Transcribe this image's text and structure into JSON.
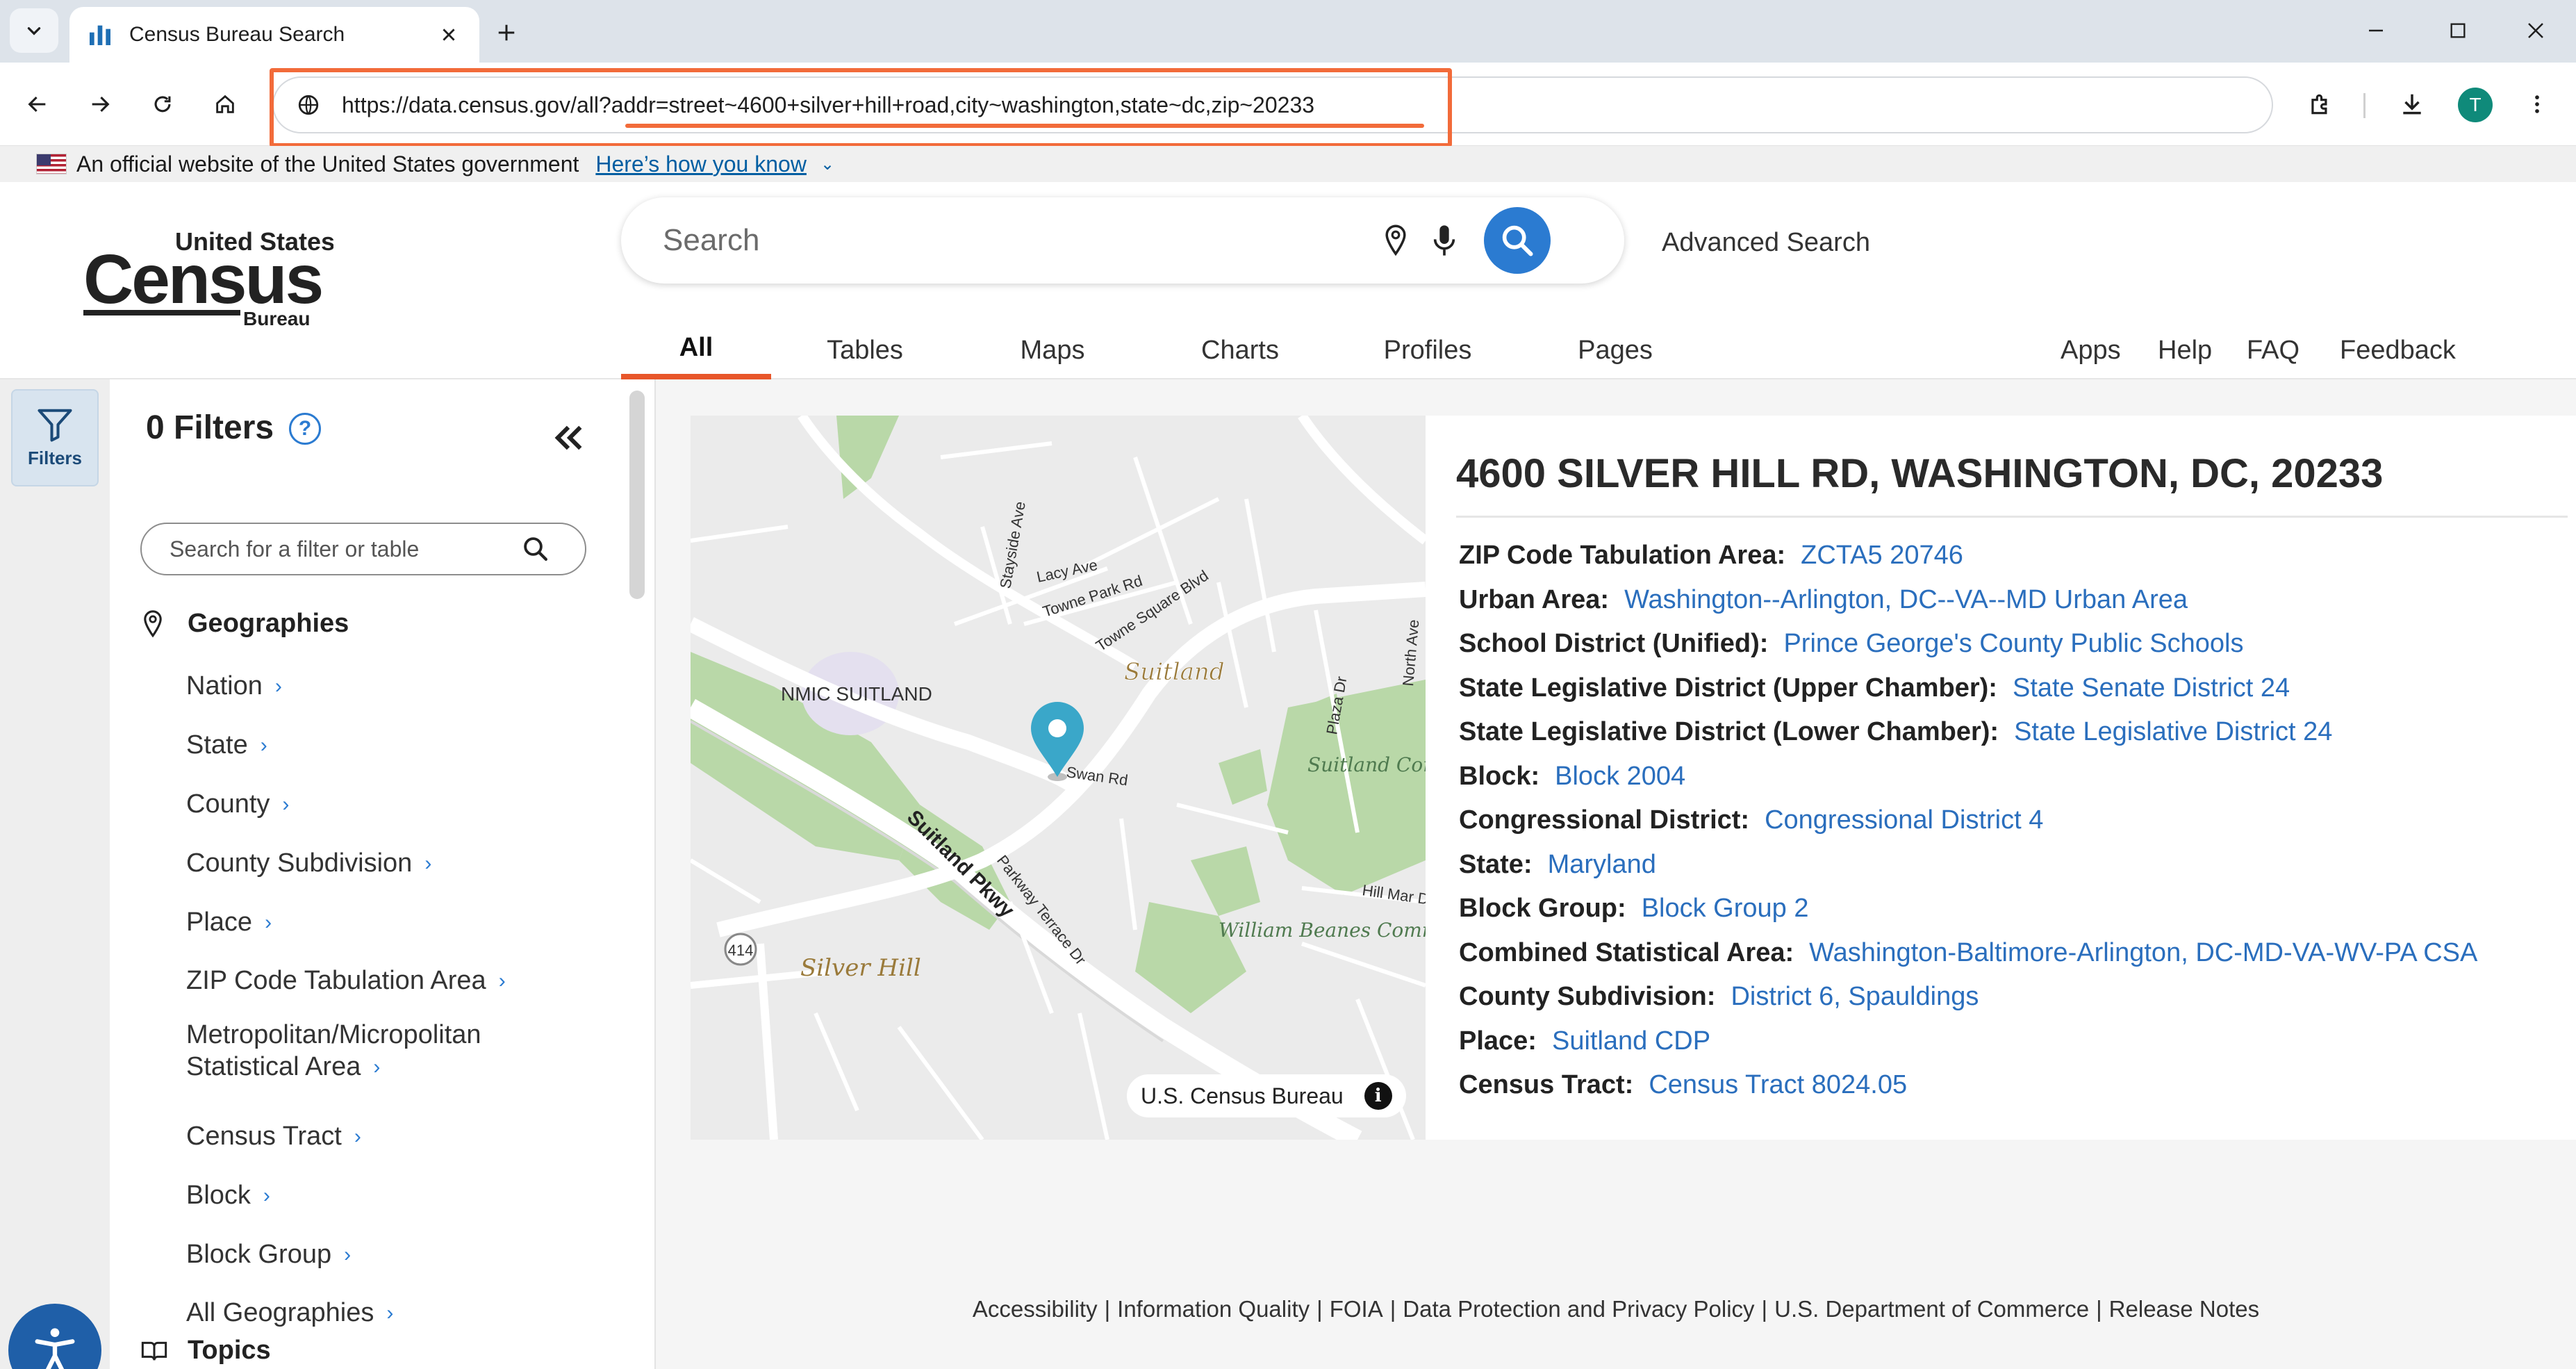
{
  "browser": {
    "tab_title": "Census Bureau Search",
    "url_host": "https://data.census.gov/",
    "url_path": "all?addr=street~4600+silver+hill+road,city~washington,state~dc,zip~20233",
    "profile_initial": "T"
  },
  "gov_banner": {
    "text": "An official website of the United States government",
    "link": "Here’s how you know"
  },
  "logo": {
    "line1": "United States",
    "line2": "Census",
    "line3": "Bureau"
  },
  "search": {
    "placeholder": "Search",
    "advanced": "Advanced Search"
  },
  "tabs": [
    "All",
    "Tables",
    "Maps",
    "Charts",
    "Profiles",
    "Pages"
  ],
  "right_links": [
    "Apps",
    "Help",
    "FAQ",
    "Feedback"
  ],
  "rail": {
    "filters_label": "Filters"
  },
  "filter_panel": {
    "title": "0 Filters",
    "help": "?",
    "search_placeholder": "Search for a filter or table",
    "geographies_heading": "Geographies",
    "geographies": [
      "Nation",
      "State",
      "County",
      "County Subdivision",
      "Place",
      "ZIP Code Tabulation Area",
      "Metropolitan/Micropolitan",
      "Statistical Area",
      "Census Tract",
      "Block",
      "Block Group",
      "All Geographies"
    ],
    "topics_heading": "Topics"
  },
  "map": {
    "labels": {
      "nmic": "NMIC SUITLAND",
      "suitland": "Suitland",
      "suitland_park": "Suitland Community Park",
      "silver_hill": "Silver Hill",
      "beanes": "William Beanes Community Center",
      "suitland_pkwy": "Suitland Pkwy",
      "lacy": "Lacy Ave",
      "towne_park": "Towne Park Rd",
      "towne_square": "Towne Square Blvd",
      "swan": "Swan Rd",
      "parkway_terrace": "Parkway Terrace Dr",
      "plaza": "Plaza Dr",
      "hill_mar": "Hill Mar Dr",
      "north": "North Ave",
      "stayside": "Stayside Ave",
      "route": "414"
    },
    "attribution": "U.S. Census Bureau",
    "info": "i"
  },
  "result": {
    "address": "4600 SILVER HILL RD, WASHINGTON, DC, 20233",
    "facts": [
      {
        "label": "ZIP Code Tabulation Area:",
        "value": "ZCTA5 20746"
      },
      {
        "label": "Urban Area:",
        "value": "Washington--Arlington, DC--VA--MD Urban Area"
      },
      {
        "label": "School District (Unified):",
        "value": "Prince George's County Public Schools"
      },
      {
        "label": "State Legislative District (Upper Chamber):",
        "value": "State Senate District 24"
      },
      {
        "label": "State Legislative District (Lower Chamber):",
        "value": "State Legislative District 24"
      },
      {
        "label": "Block:",
        "value": "Block 2004"
      },
      {
        "label": "Congressional District:",
        "value": "Congressional District 4"
      },
      {
        "label": "State:",
        "value": "Maryland"
      },
      {
        "label": "Block Group:",
        "value": "Block Group 2"
      },
      {
        "label": "Combined Statistical Area:",
        "value": "Washington-Baltimore-Arlington, DC-MD-VA-WV-PA CSA"
      },
      {
        "label": "County Subdivision:",
        "value": "District 6, Spauldings"
      },
      {
        "label": "Place:",
        "value": "Suitland CDP"
      },
      {
        "label": "Census Tract:",
        "value": "Census Tract 8024.05"
      }
    ]
  },
  "footer": [
    "Accessibility",
    "Information Quality",
    "FOIA",
    "Data Protection and Privacy Policy",
    "U.S. Department of Commerce",
    "Release Notes"
  ],
  "colors": {
    "accent_blue": "#2b7bd1",
    "link_blue": "#2a6ebd",
    "tab_underline": "#e8562a",
    "url_highlight": "#f26b3a",
    "map_pin": "#3aa7c9"
  }
}
